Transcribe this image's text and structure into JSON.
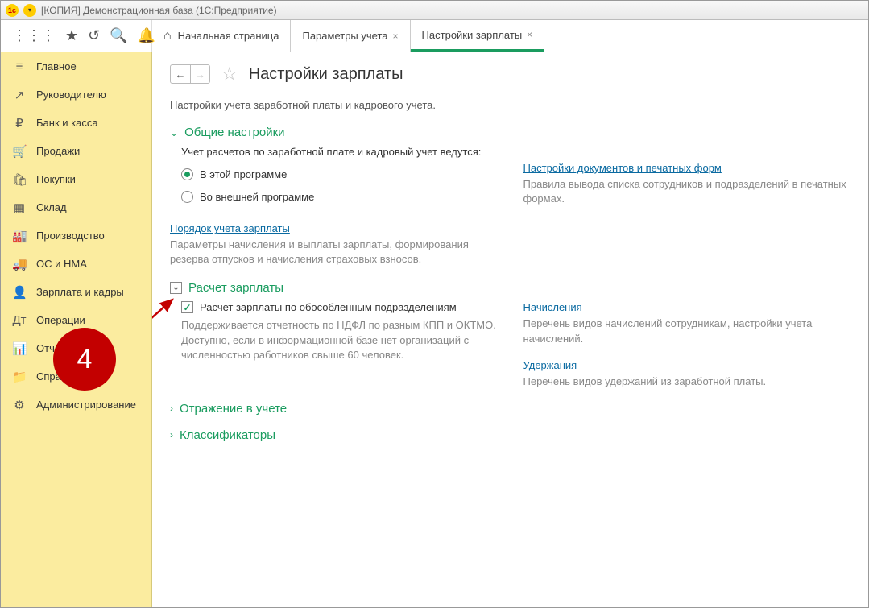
{
  "window": {
    "title": "[КОПИЯ] Демонстрационная база  (1С:Предприятие)"
  },
  "tabs": [
    {
      "label": "Начальная страница",
      "home": true
    },
    {
      "label": "Параметры учета",
      "closable": true
    },
    {
      "label": "Настройки зарплаты",
      "closable": true,
      "active": true
    }
  ],
  "sidebar": {
    "items": [
      {
        "icon": "≡",
        "label": "Главное"
      },
      {
        "icon": "↗",
        "label": "Руководителю"
      },
      {
        "icon": "₽",
        "label": "Банк и касса"
      },
      {
        "icon": "🛒",
        "label": "Продажи"
      },
      {
        "icon": "🛍",
        "label": "Покупки"
      },
      {
        "icon": "▦",
        "label": "Склад"
      },
      {
        "icon": "🏭",
        "label": "Производство"
      },
      {
        "icon": "🚚",
        "label": "ОС и НМА"
      },
      {
        "icon": "👤",
        "label": "Зарплата и кадры"
      },
      {
        "icon": "Дт",
        "label": "Операции"
      },
      {
        "icon": "📊",
        "label": "Отчеты"
      },
      {
        "icon": "📁",
        "label": "Справочники"
      },
      {
        "icon": "⚙",
        "label": "Администрирование"
      }
    ]
  },
  "page": {
    "title": "Настройки зарплаты",
    "subtitle": "Настройки учета заработной платы и кадрового учета."
  },
  "sections": {
    "general": {
      "title": "Общие настройки",
      "field_label": "Учет расчетов по заработной плате и кадровый учет ведутся:",
      "radio": {
        "opt1": "В этой программе",
        "opt2": "Во внешней программе"
      },
      "link": "Порядок учета зарплаты",
      "link_desc": "Параметры начисления и выплаты зарплаты, формирования резерва отпусков и начисления страховых взносов.",
      "right_link": "Настройки документов и печатных форм",
      "right_desc": "Правила вывода списка сотрудников и подразделений в печатных формах."
    },
    "salary": {
      "title": "Расчет зарплаты",
      "checkbox_label": "Расчет зарплаты по обособленным подразделениям",
      "checkbox_desc": "Поддерживается отчетность по НДФЛ по разным КПП и ОКТМО. Доступно, если в информационной базе нет организаций с численностью работников свыше 60 человек.",
      "right": {
        "link1": "Начисления",
        "desc1": "Перечень видов начислений сотрудникам, настройки учета начислений.",
        "link2": "Удержания",
        "desc2": "Перечень видов удержаний из заработной платы."
      }
    },
    "reflection": {
      "title": "Отражение в учете"
    },
    "classifiers": {
      "title": "Классификаторы"
    }
  },
  "annotation": {
    "number": "4"
  }
}
